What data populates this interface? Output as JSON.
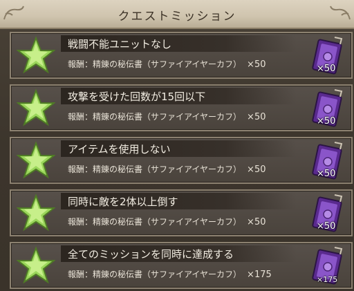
{
  "header": {
    "title": "クエストミッション"
  },
  "missions": [
    {
      "name": "戦闘不能ユニットなし",
      "reward_label": "報酬：精錬の秘伝書（サファイアイヤーカフ）",
      "reward_qty": "×50",
      "item_count": "×50",
      "star_icon": "green-star-icon",
      "item_icon": "purple-book-icon"
    },
    {
      "name": "攻撃を受けた回数が15回以下",
      "reward_label": "報酬：精錬の秘伝書（サファイアイヤーカフ）",
      "reward_qty": "×50",
      "item_count": "×50",
      "star_icon": "green-star-icon",
      "item_icon": "purple-book-icon"
    },
    {
      "name": "アイテムを使用しない",
      "reward_label": "報酬：精錬の秘伝書（サファイアイヤーカフ）",
      "reward_qty": "×50",
      "item_count": "×50",
      "star_icon": "green-star-icon",
      "item_icon": "purple-book-icon"
    },
    {
      "name": "同時に敵を2体以上倒す",
      "reward_label": "報酬：精錬の秘伝書（サファイアイヤーカフ）",
      "reward_qty": "×50",
      "item_count": "×50",
      "star_icon": "green-star-icon",
      "item_icon": "purple-book-icon"
    },
    {
      "name": "全てのミッションを同時に達成する",
      "reward_label": "報酬：精錬の秘伝書（サファイアイヤーカフ）",
      "reward_qty": "×175",
      "item_count": "×175",
      "star_icon": "green-star-icon",
      "item_icon": "purple-book-icon"
    }
  ],
  "colors": {
    "star": "#8fd14f",
    "item": "#7b3fb8",
    "panel": "#4f4841",
    "header": "#d6cbb6"
  }
}
